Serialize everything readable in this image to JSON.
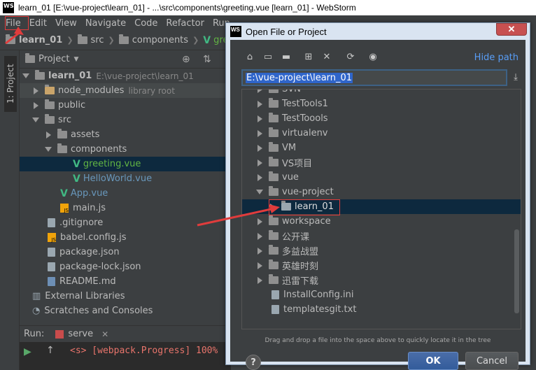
{
  "window": {
    "title": "learn_01 [E:\\vue-project\\learn_01] - ...\\src\\components\\greeting.vue [learn_01] - WebStorm",
    "app_badge": "WS"
  },
  "menu": [
    "File",
    "Edit",
    "View",
    "Navigate",
    "Code",
    "Refactor",
    "Run"
  ],
  "breadcrumb": [
    "learn_01",
    "src",
    "components",
    "greeting."
  ],
  "side_tab": "1: Project",
  "project_panel": {
    "title": "Project"
  },
  "tree": [
    {
      "label": "learn_01",
      "note": "E:\\vue-project\\learn_01",
      "kind": "folder-open"
    },
    {
      "label": "node_modules",
      "note": "library root",
      "kind": "folder-closed"
    },
    {
      "label": "public",
      "kind": "folder-closed"
    },
    {
      "label": "src",
      "kind": "folder-open"
    },
    {
      "label": "assets",
      "kind": "folder-closed"
    },
    {
      "label": "components",
      "kind": "folder-open"
    },
    {
      "label": "greeting.vue",
      "kind": "vue"
    },
    {
      "label": "HelloWorld.vue",
      "kind": "vue"
    },
    {
      "label": "App.vue",
      "kind": "vue"
    },
    {
      "label": "main.js",
      "kind": "js"
    },
    {
      "label": ".gitignore",
      "kind": "file"
    },
    {
      "label": "babel.config.js",
      "kind": "js"
    },
    {
      "label": "package.json",
      "kind": "file"
    },
    {
      "label": "package-lock.json",
      "kind": "file"
    },
    {
      "label": "README.md",
      "kind": "file"
    },
    {
      "label": "External Libraries",
      "kind": "lib"
    },
    {
      "label": "Scratches and Consoles",
      "kind": "scratch"
    }
  ],
  "run": {
    "label": "Run:",
    "tab": "serve",
    "output": "<s> [webpack.Progress] 100%"
  },
  "dialog": {
    "title": "Open File or Project",
    "close": "✕",
    "hide_path": "Hide path",
    "path": "E:\\vue-project\\learn_01",
    "items": [
      {
        "label": "SVN",
        "kind": "folder-closed"
      },
      {
        "label": "TestTools1",
        "kind": "folder-closed"
      },
      {
        "label": "TestToools",
        "kind": "folder-closed"
      },
      {
        "label": "virtualenv",
        "kind": "folder-closed"
      },
      {
        "label": "VM",
        "kind": "folder-closed"
      },
      {
        "label": "VS项目",
        "kind": "folder-closed"
      },
      {
        "label": "vue",
        "kind": "folder-closed"
      },
      {
        "label": "vue-project",
        "kind": "folder-open"
      },
      {
        "label": "learn_01",
        "kind": "project"
      },
      {
        "label": "workspace",
        "kind": "folder-closed"
      },
      {
        "label": "公开课",
        "kind": "folder-closed"
      },
      {
        "label": "多益战盟",
        "kind": "folder-closed"
      },
      {
        "label": "英雄时刻",
        "kind": "folder-closed"
      },
      {
        "label": "迅雷下载",
        "kind": "folder-closed"
      },
      {
        "label": "InstallConfig.ini",
        "kind": "file"
      },
      {
        "label": "templatesgit.txt",
        "kind": "file"
      }
    ],
    "hint": "Drag and drop a file into the space above to quickly locate it in the tree",
    "ok": "OK",
    "cancel": "Cancel",
    "help": "?"
  },
  "accent": {
    "annotation": "#e03c3c",
    "selection": "#0d293e",
    "link": "#589df6"
  }
}
